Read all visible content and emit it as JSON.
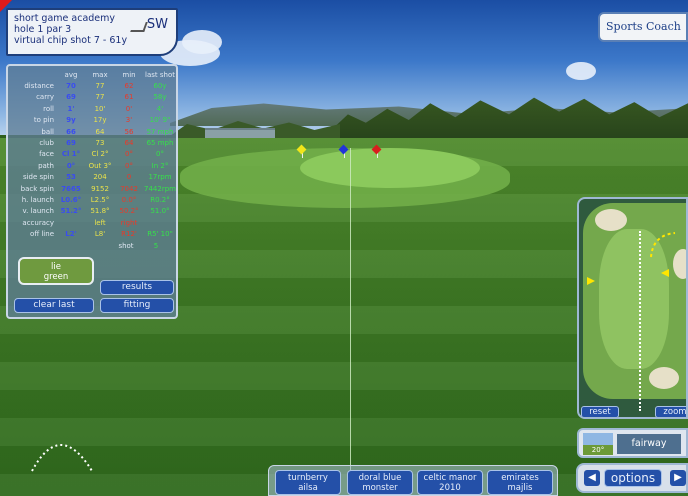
{
  "hole_info": {
    "line1": "short game academy",
    "line2": "hole 1 par 3",
    "line3": "virtual chip shot 7 - 61y",
    "club": "SW"
  },
  "stats": {
    "headers": [
      "avg",
      "max",
      "min",
      "last shot"
    ],
    "rows": [
      {
        "label": "distance",
        "avg": "70",
        "max": "77",
        "min": "62",
        "last": "60y"
      },
      {
        "label": "carry",
        "avg": "69",
        "max": "77",
        "min": "61",
        "last": "58y"
      },
      {
        "label": "roll",
        "avg": "1'",
        "max": "10'",
        "min": "0'",
        "last": "4'"
      },
      {
        "label": "to pin",
        "avg": "9y",
        "max": "17y",
        "last": "10' 9\"",
        "min": "3'"
      },
      {
        "label": "ball",
        "avg": "66",
        "max": "64",
        "min": "56",
        "last": "57 mph"
      },
      {
        "label": "club",
        "avg": "69",
        "max": "73",
        "min": "64",
        "last": "65 mph"
      },
      {
        "label": "face",
        "avg": "Cl 1°",
        "max": "Cl 2°",
        "min": "0°",
        "last": "0°"
      },
      {
        "label": "path",
        "avg": "0°",
        "max": "Out 3°",
        "min": "0°",
        "last": "In 2°"
      },
      {
        "label": "side spin",
        "avg": "53",
        "max": "204",
        "min": "0",
        "last": "17rpm"
      },
      {
        "label": "back spin",
        "avg": "7665",
        "max": "9152",
        "min": "7042",
        "last": "7442rpm"
      },
      {
        "label": "h. launch",
        "avg": "L0.6°",
        "max": "L2.5°",
        "min": "0.0°",
        "last": "R0.2°"
      },
      {
        "label": "v. launch",
        "avg": "51.2°",
        "max": "51.8°",
        "min": "50.2°",
        "last": "51.0°"
      },
      {
        "label": "accuracy",
        "avg": "",
        "max": "left",
        "min": "right",
        "last": ""
      },
      {
        "label": "off line",
        "avg": "L2'",
        "max": "L8'",
        "min": "R12'",
        "last": "R5' 10\""
      }
    ],
    "shot_label": "shot",
    "shot_value": "5",
    "lie_button": "lie\ngreen",
    "results_button": "results",
    "clear_last_button": "clear last",
    "fitting_button": "fitting"
  },
  "logo_text": "Sports Coach",
  "minimap": {
    "reset_button": "reset",
    "zoom_button": "zoom"
  },
  "lie": {
    "degrees": "20°",
    "label": "fairway"
  },
  "options": {
    "label": "options",
    "prev": "◀",
    "next": "▶"
  },
  "courses": [
    {
      "line1": "turnberry",
      "line2": "ailsa"
    },
    {
      "line1": "doral blue",
      "line2": "monster"
    },
    {
      "line1": "celtic manor",
      "line2": "2010"
    },
    {
      "line1": "emirates",
      "line2": "majlis"
    }
  ],
  "flag_colors": {
    "yellow": "#f1e51a",
    "blue": "#2234d8",
    "red": "#d81e1e"
  }
}
